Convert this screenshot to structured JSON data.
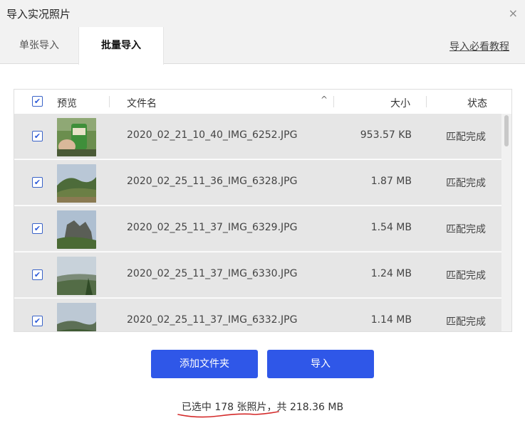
{
  "window": {
    "title": "导入实况照片",
    "close_glyph": "×"
  },
  "tabs": [
    {
      "label": "单张导入",
      "active": false
    },
    {
      "label": "批量导入",
      "active": true
    }
  ],
  "tutorial_link": "导入必看教程",
  "table": {
    "headers": {
      "preview": "预览",
      "name": "文件名",
      "size": "大小",
      "status": "状态"
    },
    "sort_glyph": "^",
    "check_glyph": "✔",
    "rows": [
      {
        "name": "2020_02_21_10_40_IMG_6252.JPG",
        "size": "953.57 KB",
        "status": "匹配完成"
      },
      {
        "name": "2020_02_25_11_36_IMG_6328.JPG",
        "size": "1.87 MB",
        "status": "匹配完成"
      },
      {
        "name": "2020_02_25_11_37_IMG_6329.JPG",
        "size": "1.54 MB",
        "status": "匹配完成"
      },
      {
        "name": "2020_02_25_11_37_IMG_6330.JPG",
        "size": "1.24 MB",
        "status": "匹配完成"
      },
      {
        "name": "2020_02_25_11_37_IMG_6332.JPG",
        "size": "1.14 MB",
        "status": "匹配完成"
      }
    ]
  },
  "buttons": {
    "add_folder": "添加文件夹",
    "import": "导入"
  },
  "summary": "已选中 178 张照片，共 218.36 MB",
  "colors": {
    "accent": "#2f57e8",
    "annotation": "#d42a2a"
  }
}
